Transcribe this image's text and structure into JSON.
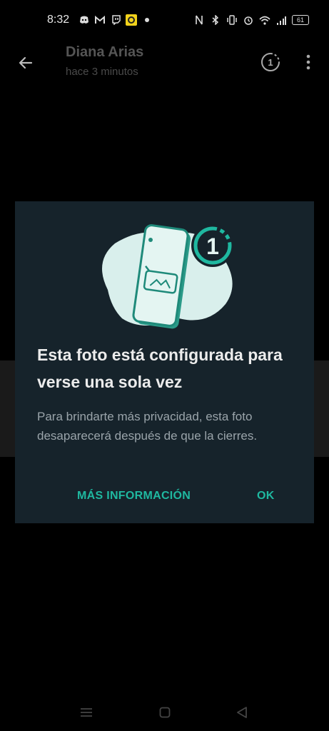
{
  "status_bar": {
    "time": "8:32",
    "battery": "61"
  },
  "header": {
    "title": "Diana Arias",
    "subtitle": "hace 3 minutos"
  },
  "dialog": {
    "badge_number": "1",
    "title": "Esta foto está configurada para verse una sola vez",
    "body": "Para brindarte más privacidad, esta foto desaparecerá después de que la cierres.",
    "more_info_label": "MÁS INFORMACIÓN",
    "ok_label": "OK"
  },
  "colors": {
    "accent": "#1fb8a0",
    "dialog_bg": "#16232b",
    "background": "#000000"
  },
  "icons": {
    "back": "arrow-left-icon",
    "timer": "view-once-icon",
    "menu": "more-vert-icon"
  }
}
